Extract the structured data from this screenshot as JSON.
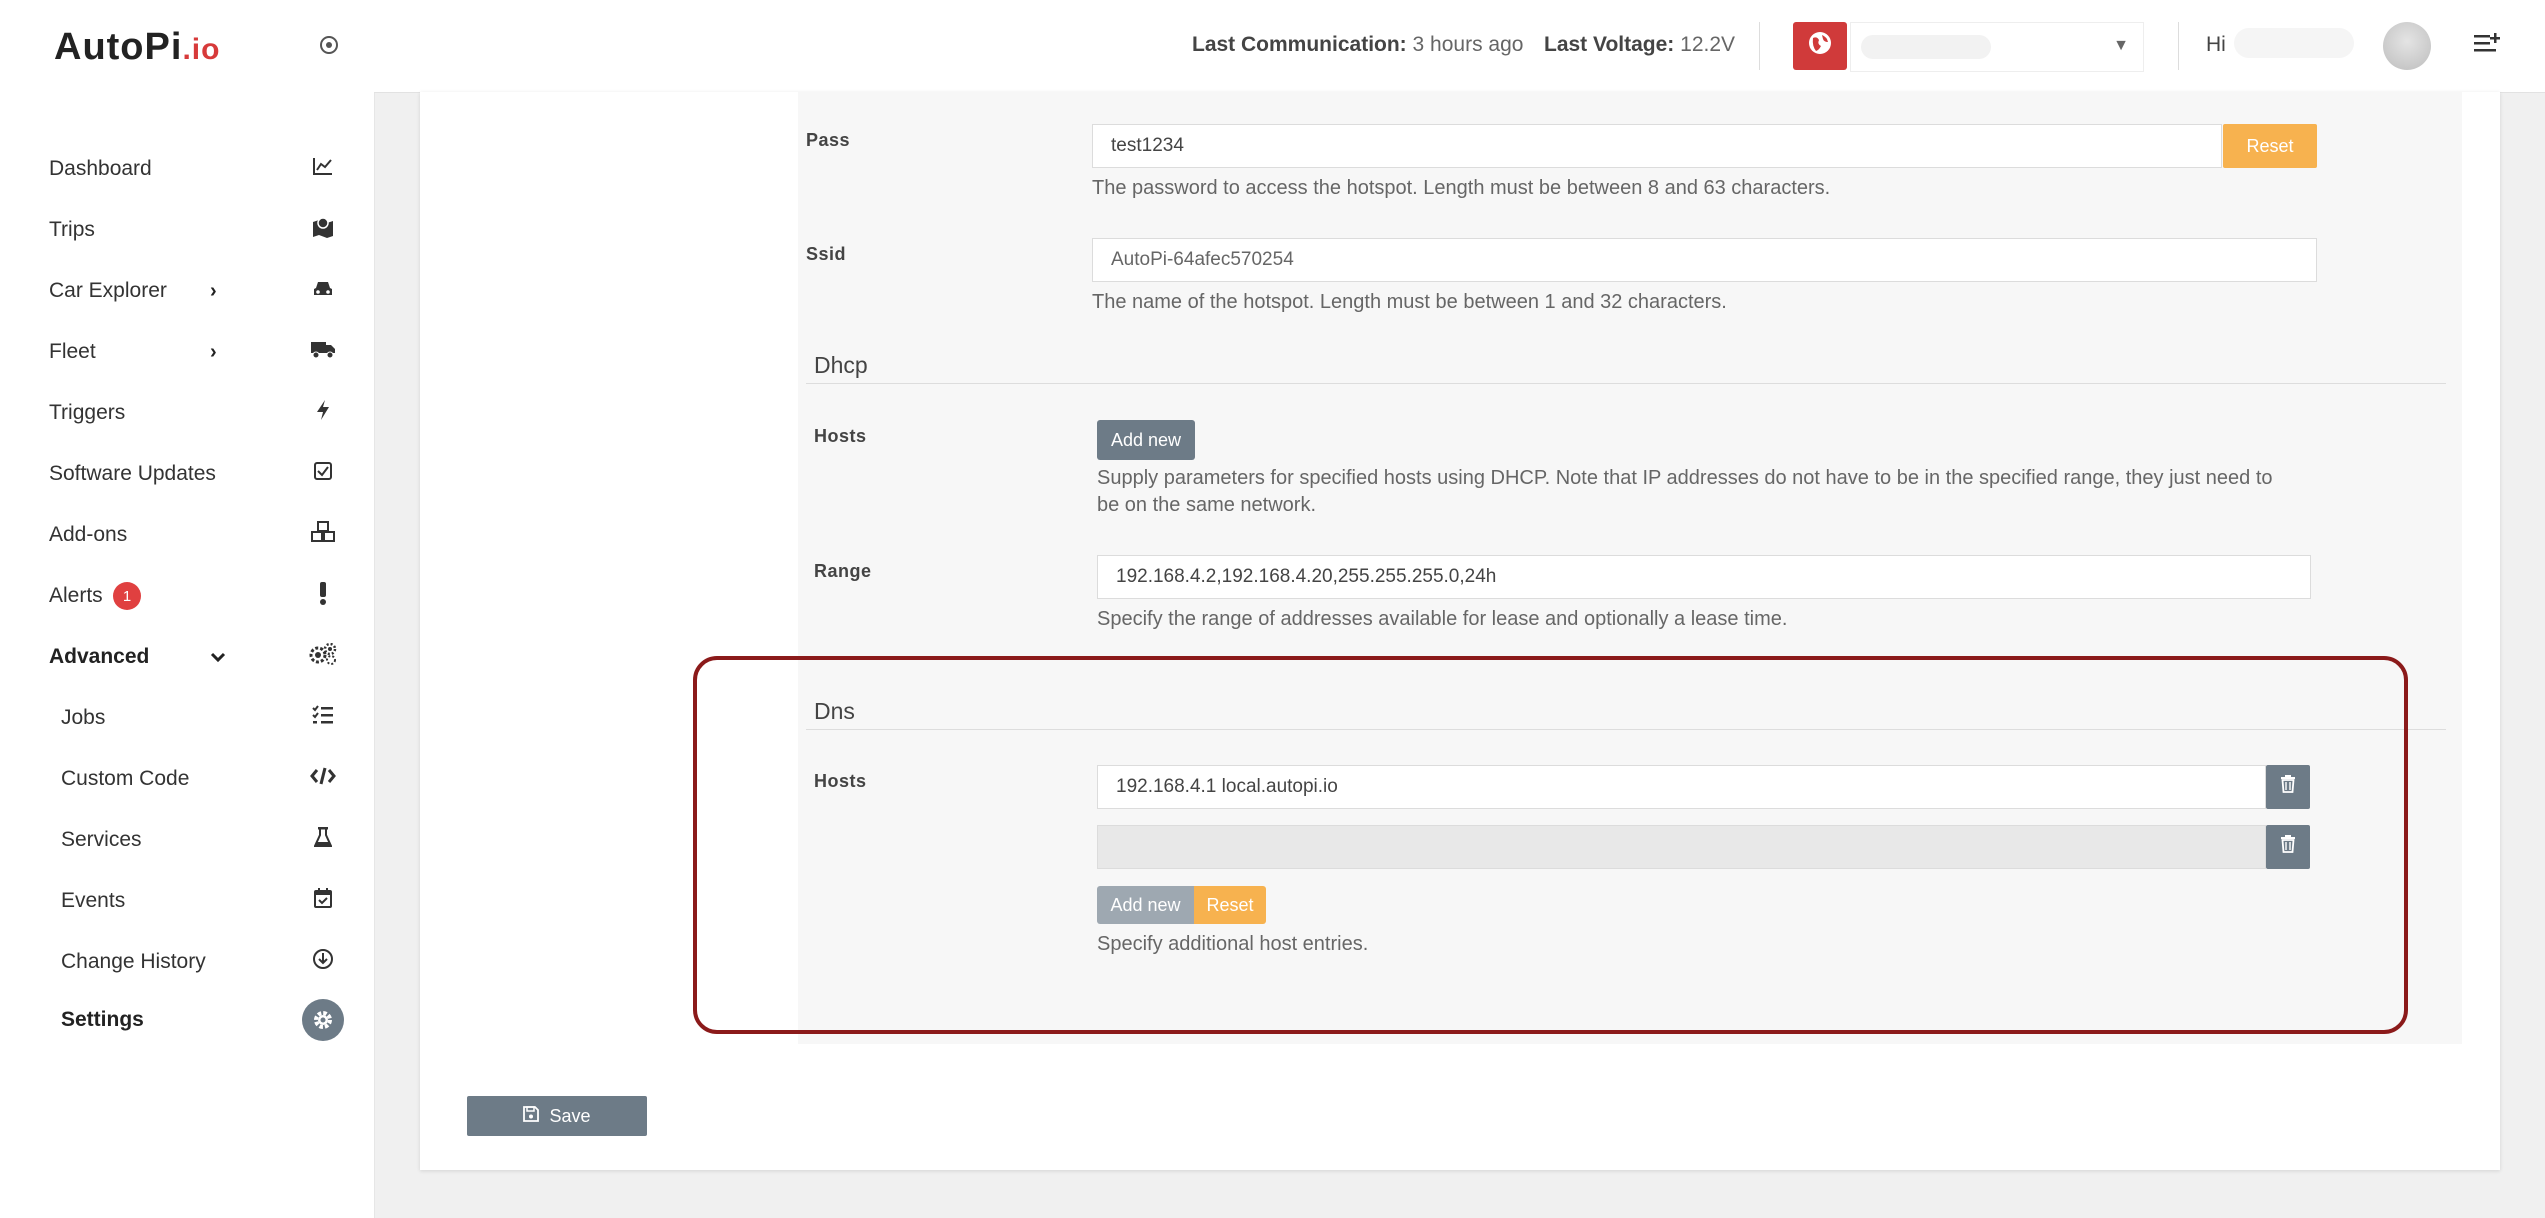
{
  "brand": {
    "name_part1": "AutoPi",
    "name_part2": ".io"
  },
  "sidebar": {
    "items": [
      {
        "label": "Dashboard",
        "icon": "chart-line-icon",
        "glyph": "📈"
      },
      {
        "label": "Trips",
        "icon": "map-marked-icon",
        "glyph": "🗺"
      },
      {
        "label": "Car Explorer",
        "icon": "car-icon",
        "glyph": "🚗",
        "chevron": "›"
      },
      {
        "label": "Fleet",
        "icon": "truck-icon",
        "glyph": "🚚",
        "chevron": "›"
      },
      {
        "label": "Triggers",
        "icon": "bolt-icon",
        "glyph": "⚡"
      },
      {
        "label": "Software Updates",
        "icon": "check-square-icon",
        "glyph": "☑"
      },
      {
        "label": "Add-ons",
        "icon": "cubes-icon",
        "glyph": "⬡"
      },
      {
        "label": "Alerts",
        "icon": "exclamation-icon",
        "glyph": "!",
        "badge": "1"
      },
      {
        "label": "Advanced",
        "icon": "cogs-icon",
        "glyph": "⚙",
        "chevron": "⌄"
      },
      {
        "label": "Jobs",
        "icon": "tasks-icon",
        "glyph": "☰"
      },
      {
        "label": "Custom Code",
        "icon": "code-icon",
        "glyph": "</>"
      },
      {
        "label": "Services",
        "icon": "flask-icon",
        "glyph": "⚗"
      },
      {
        "label": "Events",
        "icon": "calendar-check-icon",
        "glyph": "📅"
      },
      {
        "label": "Change History",
        "icon": "arrow-circle-down-icon",
        "glyph": "⊙"
      },
      {
        "label": "Settings",
        "icon": "gear-icon",
        "glyph": "⚙"
      }
    ]
  },
  "header": {
    "last_comm_label": "Last Communication:",
    "last_comm_value": "3 hours ago",
    "last_voltage_label": "Last Voltage:",
    "last_voltage_value": "12.2V",
    "greeting": "Hi"
  },
  "hotspot": {
    "pass_label": "Pass",
    "pass_value": "test1234",
    "pass_reset": "Reset",
    "pass_help": "The password to access the hotspot. Length must be between 8 and 63 characters.",
    "ssid_label": "Ssid",
    "ssid_value": "AutoPi-64afec570254",
    "ssid_help": "The name of the hotspot. Length must be between 1 and 32 characters."
  },
  "dhcp": {
    "title": "Dhcp",
    "hosts_label": "Hosts",
    "add_new": "Add new",
    "hosts_help_1": "Supply parameters for specified hosts using DHCP. Note that IP addresses do not have to be in the specified range, they just need to",
    "hosts_help_2": "be on the same network.",
    "range_label": "Range",
    "range_value": "192.168.4.2,192.168.4.20,255.255.255.0,24h",
    "range_help": "Specify the range of addresses available for lease and optionally a lease time."
  },
  "dns": {
    "title": "Dns",
    "hosts_label": "Hosts",
    "host_entry_1": "192.168.4.1 local.autopi.io",
    "host_entry_2": "",
    "add_new": "Add new",
    "reset": "Reset",
    "help": "Specify additional host entries."
  },
  "actions": {
    "save": "Save"
  }
}
